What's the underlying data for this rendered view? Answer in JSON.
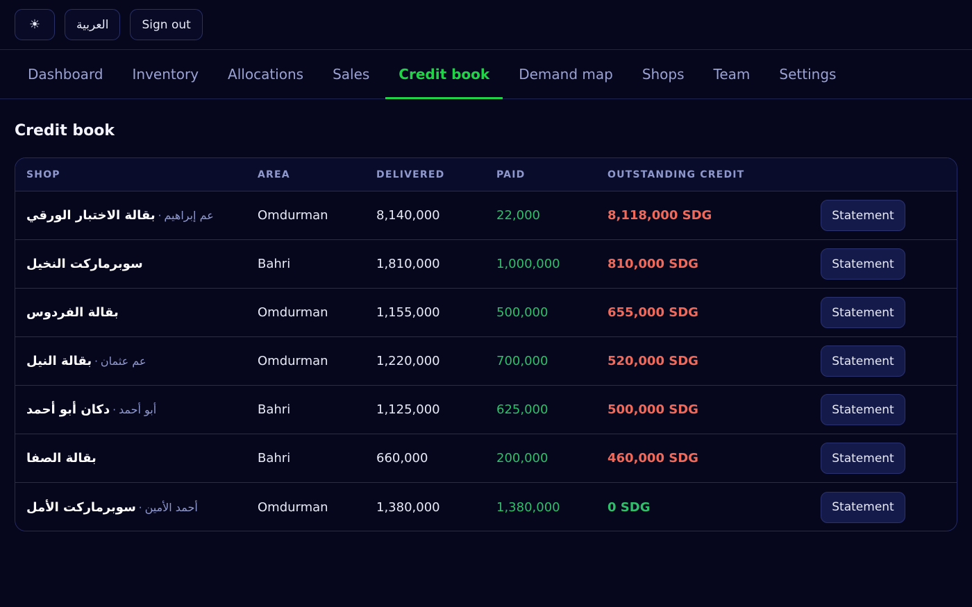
{
  "topbar": {
    "theme_icon": "☀",
    "lang_label": "العربية",
    "signout_label": "Sign out"
  },
  "tabs": [
    {
      "label": "Dashboard",
      "active": false
    },
    {
      "label": "Inventory",
      "active": false
    },
    {
      "label": "Allocations",
      "active": false
    },
    {
      "label": "Sales",
      "active": false
    },
    {
      "label": "Credit book",
      "active": true
    },
    {
      "label": "Demand map",
      "active": false
    },
    {
      "label": "Shops",
      "active": false
    },
    {
      "label": "Team",
      "active": false
    },
    {
      "label": "Settings",
      "active": false
    }
  ],
  "page": {
    "title": "Credit book"
  },
  "table": {
    "headers": {
      "shop": "SHOP",
      "area": "AREA",
      "delivered": "DELIVERED",
      "paid": "PAID",
      "outstanding": "OUTSTANDING CREDIT"
    },
    "statement_label": "Statement",
    "separator": "·",
    "rows": [
      {
        "shop": "بقالة الاختبار الورقي",
        "owner": "عم إبراهيم",
        "area": "Omdurman",
        "delivered": "8,140,000",
        "paid": "22,000",
        "outstanding": "8,118,000 SDG",
        "status": "red"
      },
      {
        "shop": "سوبرماركت النخيل",
        "owner": "",
        "area": "Bahri",
        "delivered": "1,810,000",
        "paid": "1,000,000",
        "outstanding": "810,000 SDG",
        "status": "red"
      },
      {
        "shop": "بقالة الفردوس",
        "owner": "",
        "area": "Omdurman",
        "delivered": "1,155,000",
        "paid": "500,000",
        "outstanding": "655,000 SDG",
        "status": "red"
      },
      {
        "shop": "بقالة النيل",
        "owner": "عم عثمان",
        "area": "Omdurman",
        "delivered": "1,220,000",
        "paid": "700,000",
        "outstanding": "520,000 SDG",
        "status": "red"
      },
      {
        "shop": "دكان أبو أحمد",
        "owner": "أبو أحمد",
        "area": "Bahri",
        "delivered": "1,125,000",
        "paid": "625,000",
        "outstanding": "500,000 SDG",
        "status": "red"
      },
      {
        "shop": "بقالة الصفا",
        "owner": "",
        "area": "Bahri",
        "delivered": "660,000",
        "paid": "200,000",
        "outstanding": "460,000 SDG",
        "status": "red"
      },
      {
        "shop": "سوبرماركت الأمل",
        "owner": "أحمد الأمين",
        "area": "Omdurman",
        "delivered": "1,380,000",
        "paid": "1,380,000",
        "outstanding": "0 SDG",
        "status": "green"
      }
    ]
  },
  "colors": {
    "accent": "#22d34a",
    "paid": "#2fbf6a",
    "outstanding_red": "#ef6a5a",
    "background": "#06071d"
  }
}
